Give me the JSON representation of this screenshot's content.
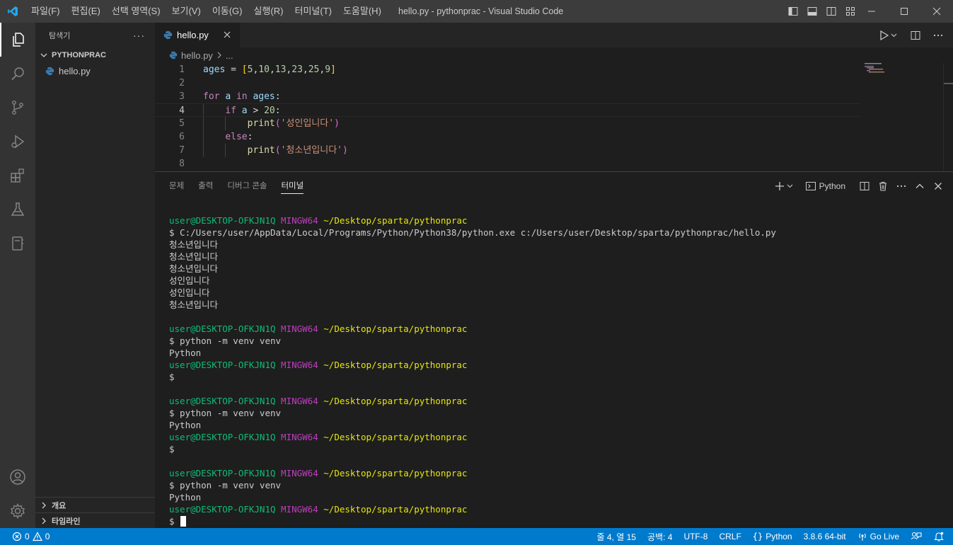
{
  "colors": {
    "titlebar": "#3c3c3c",
    "activitybar": "#333333",
    "sidebar": "#252526",
    "editor": "#1e1e1e",
    "statusbar": "#007acc",
    "accent": "#007acc"
  },
  "titlebar": {
    "app_icon": "vscode-logo-icon",
    "menu": [
      "파일(F)",
      "편집(E)",
      "선택 영역(S)",
      "보기(V)",
      "이동(G)",
      "실행(R)",
      "터미널(T)",
      "도움말(H)"
    ],
    "window_title": "hello.py - pythonprac - Visual Studio Code",
    "layout_icons": [
      "toggle-sidebar-icon",
      "toggle-panel-icon",
      "toggle-secondary-sidebar-icon",
      "customize-layout-icon"
    ],
    "window_controls": [
      "minimize-icon",
      "maximize-icon",
      "close-icon"
    ]
  },
  "activitybar": {
    "items": [
      "explorer-icon",
      "search-icon",
      "source-control-icon",
      "run-debug-icon",
      "extensions-icon",
      "testing-icon",
      "notebook-icon"
    ],
    "bottom": [
      "accounts-icon",
      "manage-gear-icon"
    ]
  },
  "sidebar": {
    "title": "탐색기",
    "more": "···",
    "folder": "PYTHONPRAC",
    "files": [
      "hello.py"
    ],
    "sections": [
      "개요",
      "타임라인"
    ]
  },
  "editor": {
    "tab_label": "hello.py",
    "breadcrumb_file": "hello.py",
    "breadcrumb_rest": "...",
    "current_line": 4,
    "lines": [
      {
        "n": "1",
        "code": "ages = [5,10,13,23,25,9]"
      },
      {
        "n": "2",
        "code": ""
      },
      {
        "n": "3",
        "code": "for a in ages:"
      },
      {
        "n": "4",
        "code": "    if a > 20:"
      },
      {
        "n": "5",
        "code": "        print('성인입니다')"
      },
      {
        "n": "6",
        "code": "    else:"
      },
      {
        "n": "7",
        "code": "        print('청소년입니다')"
      },
      {
        "n": "8",
        "code": ""
      }
    ]
  },
  "panel": {
    "tabs": [
      "문제",
      "출력",
      "디버그 콘솔",
      "터미널"
    ],
    "active_tab": "터미널",
    "shell_label": "Python",
    "terminal": {
      "user": "user@DESKTOP-OFKJN1Q",
      "system": "MINGW64",
      "path": "~/Desktop/sparta/pythonprac",
      "command_run": "$ C:/Users/user/AppData/Local/Programs/Python/Python38/python.exe c:/Users/user/Desktop/sparta/pythonprac/hello.py",
      "outputs": [
        "청소년입니다",
        "청소년입니다",
        "청소년입니다",
        "성인입니다",
        "성인입니다",
        "청소년입니다"
      ],
      "venv_command": "$ python -m venv venv",
      "venv_output": "Python",
      "prompt": "$"
    }
  },
  "statusbar": {
    "errors": "0",
    "warnings": "0",
    "position": "줄 4, 열 15",
    "indent": "공백: 4",
    "encoding": "UTF-8",
    "eol": "CRLF",
    "language": "Python",
    "interpreter": "3.8.6 64-bit",
    "golive": "Go Live"
  }
}
